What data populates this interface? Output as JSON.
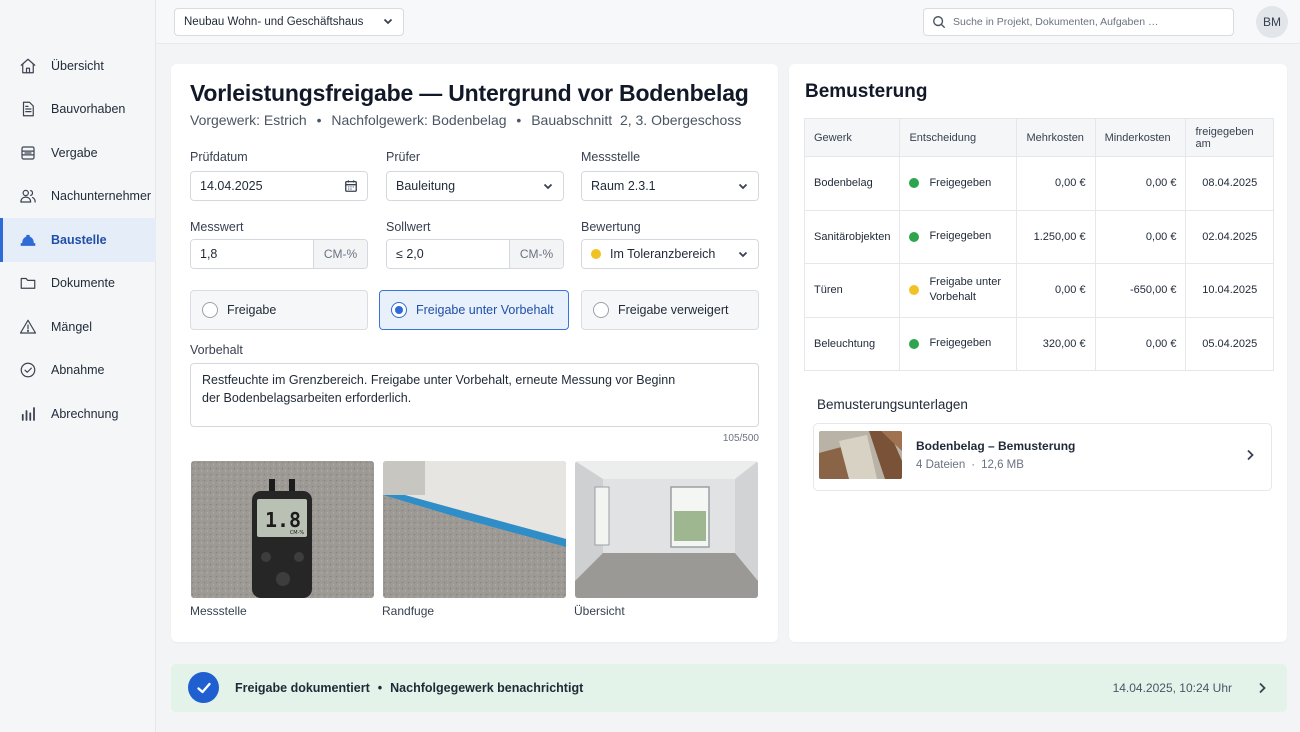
{
  "colors": {
    "accent": "#2f6bd6",
    "green": "#2ea44f",
    "yellow": "#f2c225",
    "success_bg": "#e4f3e9"
  },
  "sidebar": {
    "items": [
      {
        "label": "Übersicht",
        "icon": "home-icon"
      },
      {
        "label": "Bauvorhaben",
        "icon": "document-icon"
      },
      {
        "label": "Vergabe",
        "icon": "stack-icon"
      },
      {
        "label": "Nachunternehmer",
        "icon": "users-icon"
      },
      {
        "label": "Baustelle",
        "icon": "helmet-icon",
        "active": true
      },
      {
        "label": "Dokumente",
        "icon": "folder-icon"
      },
      {
        "label": "Mängel",
        "icon": "warning-icon"
      },
      {
        "label": "Abnahme",
        "icon": "check-circle-icon"
      },
      {
        "label": "Abrechnung",
        "icon": "bar-chart-icon"
      }
    ]
  },
  "topbar": {
    "project": "Neubau Wohn- und Geschäftshaus",
    "search_placeholder": "Suche in Projekt, Dokumenten, Aufgaben …",
    "avatar": "BM"
  },
  "main": {
    "title": "Vorleistungsfreigabe — Untergrund vor Bodenbelag",
    "subtitle": {
      "vorgewerk": "Vorgewerk: Estrich",
      "nachfolgewerk": "Nachfolgewerk: Bodenbelag",
      "bauabschnitt": "Bauabschnitt  2, 3. Obergeschoss",
      "sep": "•"
    },
    "pruefdatum": {
      "label": "Prüfdatum",
      "value": "14.04.2025"
    },
    "pruefer": {
      "label": "Prüfer",
      "value": "Bauleitung"
    },
    "messstelle": {
      "label": "Messstelle",
      "value": "Raum 2.3.1"
    },
    "messwert": {
      "label": "Messwert",
      "value": "1,8",
      "unit": "CM-%"
    },
    "sollwert": {
      "label": "Sollwert",
      "value": "≤ 2,0",
      "unit": "CM-%"
    },
    "bewertung": {
      "label": "Bewertung",
      "value": "Im Toleranzbereich"
    },
    "options": [
      {
        "label": "Freigabe",
        "selected": false
      },
      {
        "label": "Freigabe unter Vorbehalt",
        "selected": true
      },
      {
        "label": "Freigabe verweigert",
        "selected": false
      }
    ],
    "vorbehalt": {
      "label": "Vorbehalt",
      "text": "Restfeuchte im Grenzbereich. Freigabe unter Vorbehalt, erneute Messung vor Beginn der Bodenbelagsarbeiten erforderlich.",
      "counter": "105/500"
    },
    "photos": [
      {
        "caption": "Messstelle",
        "display": "1.8",
        "unit": "CM-%"
      },
      {
        "caption": "Randfuge"
      },
      {
        "caption": "Übersicht"
      }
    ]
  },
  "bemusterung": {
    "title": "Bemusterung",
    "columns": [
      "Gewerk",
      "Entscheidung",
      "Mehrkosten",
      "Minderkosten",
      "freigegeben am"
    ],
    "rows": [
      {
        "gewerk": "Bodenbelag",
        "entscheidung": "Freigegeben",
        "status": "green",
        "mehr": "0,00 €",
        "minder": "0,00 €",
        "datum": "08.04.2025"
      },
      {
        "gewerk": "Sanitärobjekten",
        "entscheidung": "Freigegeben",
        "status": "green",
        "mehr": "1.250,00 €",
        "minder": "0,00 €",
        "datum": "02.04.2025"
      },
      {
        "gewerk": "Türen",
        "entscheidung": "Freigabe unter Vorbehalt",
        "status": "yellow",
        "mehr": "0,00 €",
        "minder": "-650,00 €",
        "datum": "10.04.2025"
      },
      {
        "gewerk": "Beleuchtung",
        "entscheidung": "Freigegeben",
        "status": "green",
        "mehr": "320,00 €",
        "minder": "0,00 €",
        "datum": "05.04.2025"
      }
    ],
    "docs_title": "Bemusterungsunterlagen",
    "doc": {
      "name": "Bodenbelag – Bemusterung",
      "files": "4 Dateien",
      "size": "12,6 MB",
      "sep": "·"
    }
  },
  "statusbar": {
    "text1": "Freigabe dokumentiert",
    "sep": "•",
    "text2": "Nachfolgegewerk benachrichtigt",
    "time": "14.04.2025, 10:24 Uhr"
  }
}
